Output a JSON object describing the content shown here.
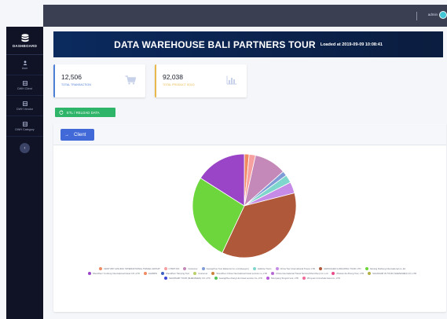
{
  "topbar": {
    "user": "admin"
  },
  "sidebar": {
    "brand": "DASHBOARD",
    "items": [
      {
        "label": "User"
      },
      {
        "label": "DWH Client"
      },
      {
        "label": "DWH Vendor"
      },
      {
        "label": "DWH Category"
      }
    ]
  },
  "banner": {
    "title": "DATA WAREHOUSE BALI PARTNERS TOUR",
    "loaded": "Loaded at 2019-09-09 10:08:41"
  },
  "stats": [
    {
      "value": "12,506",
      "label": "TOTAL TRANSACTION",
      "icon": "cart-icon",
      "color": "#4e7fd6"
    },
    {
      "value": "92,038",
      "label": "TOTAL PRODUCT SOLD",
      "icon": "bar-chart-icon",
      "color": "#e7b948"
    }
  ],
  "etl_button": {
    "label": "ETL / RELOAD DATA"
  },
  "panel": {
    "client_button": "Client"
  },
  "chart_data": {
    "type": "pie",
    "series": [
      {
        "name": "CENTURY HOLIDAY INTERNATIONAL TRAVEL GROUP",
        "value": 1.5,
        "color": "#f08a63"
      },
      {
        "name": "CTRIP INC",
        "value": 2.0,
        "color": "#f6a0a0"
      },
      {
        "name": "Customer",
        "value": 10.0,
        "color": "#c489b8"
      },
      {
        "name": "Guangzhou Tour Ekstensi Co.,Ltd (Heegon)",
        "value": 1.5,
        "color": "#7f9cd6"
      },
      {
        "name": "HelloGo Tours",
        "value": 2.5,
        "color": "#7fd6cc"
      },
      {
        "name": "China Tour International Travel, LTD",
        "value": 3.5,
        "color": "#c68be6"
      },
      {
        "name": "GENGCHEN LIANGXING TOUR, LTD",
        "value": 36.0,
        "color": "#b0583a"
      },
      {
        "name": "Jiaming Ruiheng International co.,ltd",
        "value": 27.0,
        "color": "#6dd63c"
      },
      {
        "name": "ShenZhen Yu-Dong International travel CO.,LTD",
        "value": 16.0,
        "color": "#9a44c7"
      }
    ],
    "legend": [
      {
        "name": "CENTURY HOLIDAY INTERNATIONAL TRAVEL GROUP",
        "color": "#f08a63"
      },
      {
        "name": "CTRIP INC",
        "color": "#f6a0a0"
      },
      {
        "name": "Customer",
        "color": "#c489b8"
      },
      {
        "name": "Guangzhou Tour Ekstensi Co.,Ltd (Heegon)",
        "color": "#7f9cd6"
      },
      {
        "name": "HelloGo Tours",
        "color": "#7fd6cc"
      },
      {
        "name": "China Tour International Travel, LTD",
        "color": "#c68be6"
      },
      {
        "name": "GENGCHEN LIANGXING TOUR, LTD",
        "color": "#b0583a"
      },
      {
        "name": "Jiaming Ruiheng International co.,ltd",
        "color": "#6dd63c"
      },
      {
        "name": "ShenZhen Yu-Dong International travel CO.,LTD",
        "color": "#9a44c7"
      },
      {
        "name": "GARMIN",
        "color": "#f08a63"
      },
      {
        "name": "ShenZhen Tianying Tour",
        "color": "#3c5fc2"
      },
      {
        "name": "Customer",
        "color": "#b9d06a"
      },
      {
        "name": "ShenZhen China International travel service co.,LTD",
        "color": "#c9823c"
      },
      {
        "name": "China International Travel Service(Shenzhen) Co.,Ltd",
        "color": "#b56ad4"
      },
      {
        "name": "ZhuHai Jiu Zhong Tour, LTD",
        "color": "#e94c8c"
      },
      {
        "name": "SHANSHIP IN TOUR (SHENZHEN) CO.,LTD",
        "color": "#b3b048"
      },
      {
        "name": "SHANSHIP TOUR (SHENZHEN) CO.,LTD",
        "color": "#3b47d6"
      },
      {
        "name": "GuangZhou Kang Hui travel service Co.,LTD",
        "color": "#55c45a"
      },
      {
        "name": "Shenyang Tongxin tour, LTD",
        "color": "#b65ad8"
      },
      {
        "name": "Zhuyuan Immortals travel co.,LTD",
        "color": "#f06a9a"
      }
    ]
  }
}
